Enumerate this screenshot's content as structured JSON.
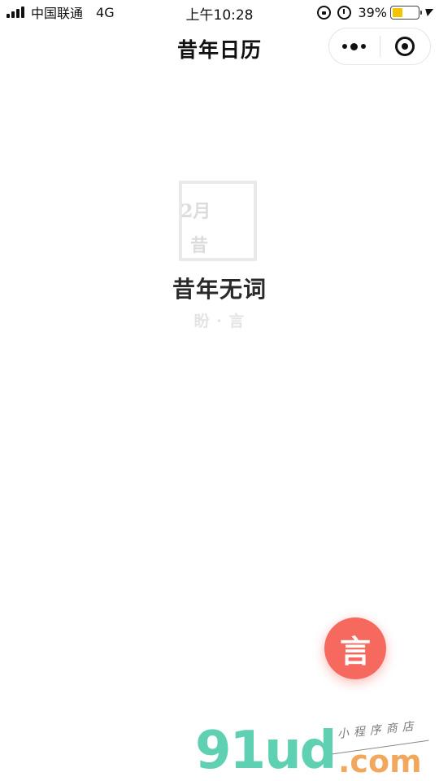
{
  "status_bar": {
    "carrier": "中国联通",
    "network": "4G",
    "time": "上午10:28",
    "battery_percent": "39%",
    "battery_level": 0.39,
    "icons": [
      "signal-icon",
      "orientation-lock-icon",
      "alarm-icon",
      "battery-icon",
      "charging-icon"
    ]
  },
  "nav": {
    "title": "昔年日历",
    "more_icon": "more-dots-icon",
    "close_icon": "close-target-icon"
  },
  "logo": {
    "month": "2月",
    "char": "昔"
  },
  "app": {
    "name": "昔年无词",
    "subtitle": "盼 · 言"
  },
  "fab": {
    "label": "言",
    "color": "#f6695f"
  },
  "watermark": {
    "brand": "91ud",
    "domain": ".com",
    "tagline": "小程序商店"
  }
}
